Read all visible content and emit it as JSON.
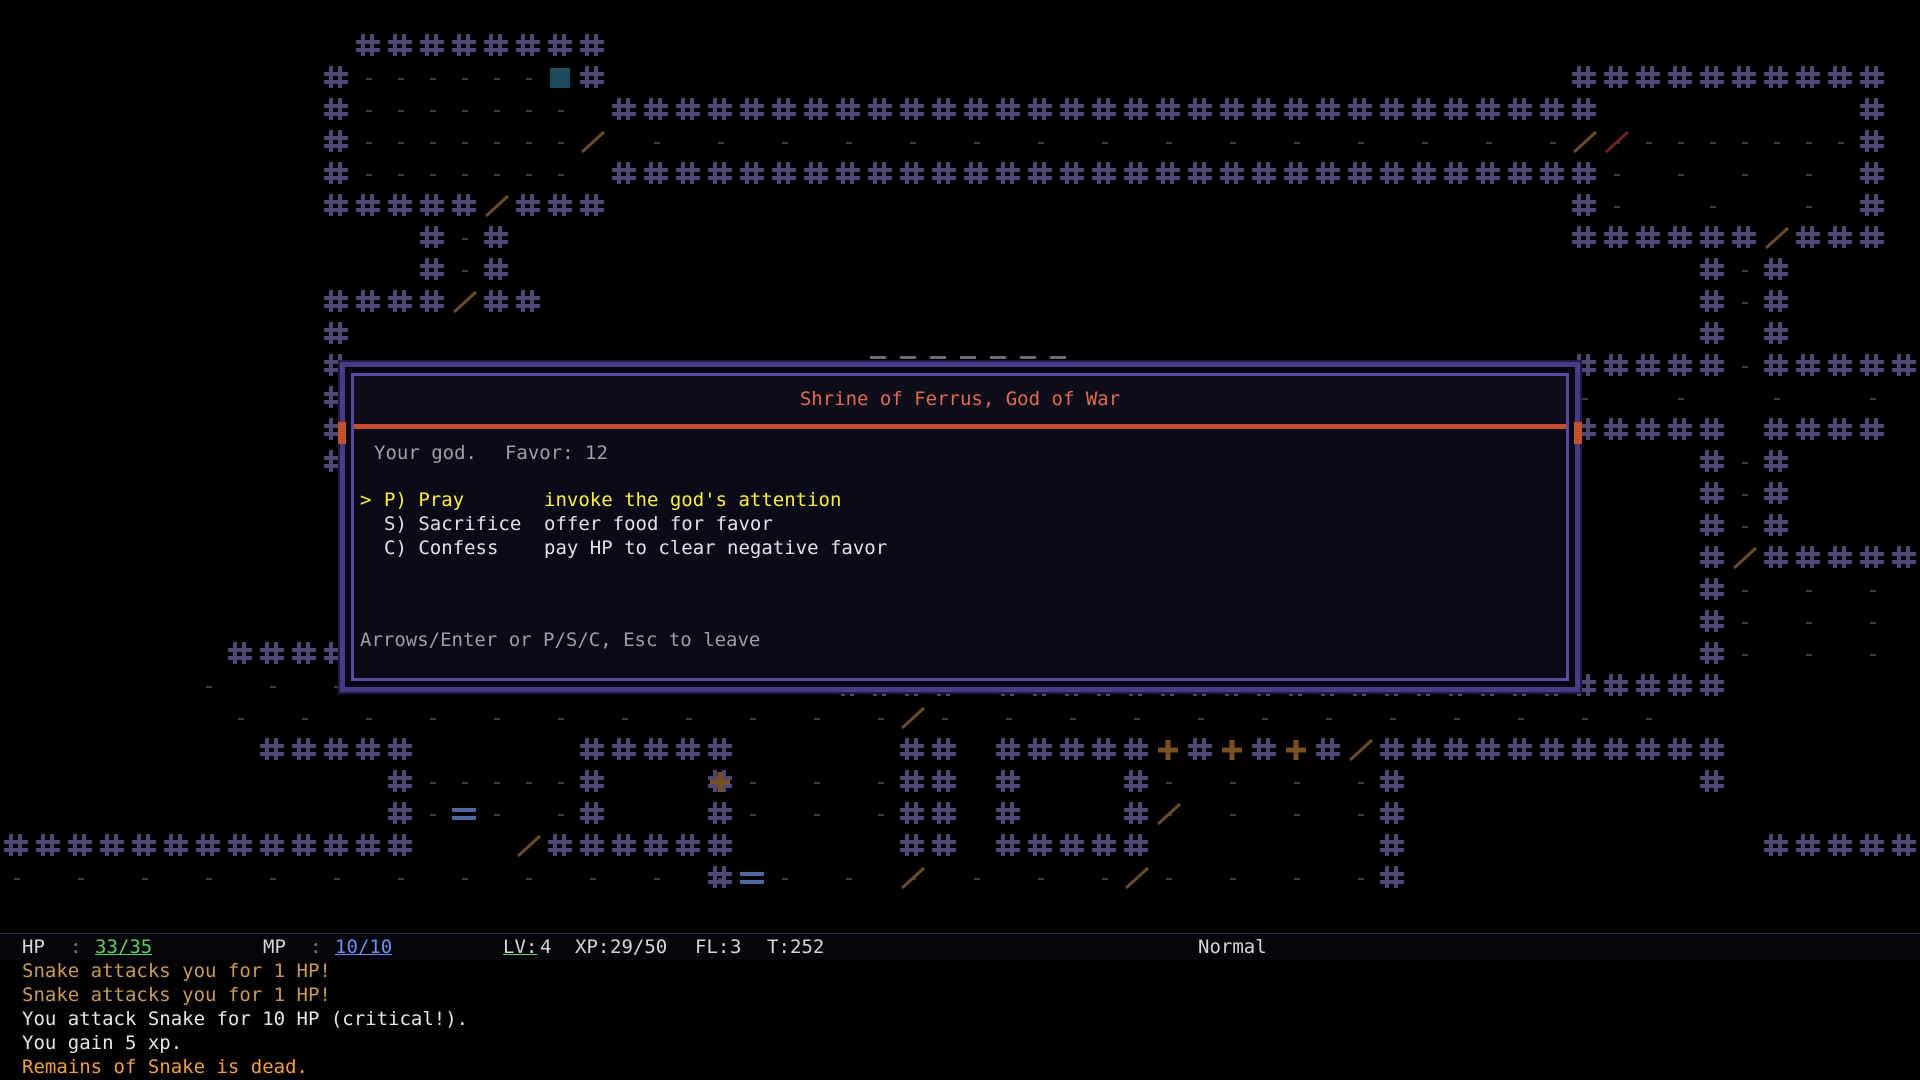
{
  "dialog": {
    "title": "Shrine of Ferrus, God of War",
    "status_text": "Your god.",
    "favor_label": "Favor:",
    "favor_value": "12",
    "options": [
      {
        "cursor": ">",
        "key": "P) Pray",
        "desc": "invoke the god's attention",
        "selected": true
      },
      {
        "cursor": "",
        "key": "S) Sacrifice",
        "desc": "offer food for favor",
        "selected": false
      },
      {
        "cursor": "",
        "key": "C) Confess",
        "desc": "pay HP to clear negative favor",
        "selected": false
      }
    ],
    "hint": "Arrows/Enter or P/S/C, Esc to leave"
  },
  "status": {
    "hp_label": "HP",
    "hp_sep": ":",
    "hp_value": "33/35",
    "mp_label": "MP",
    "mp_sep": ":",
    "mp_value": "10/10",
    "lv_label": "LV:",
    "lv_value": "4",
    "xp_label": "XP:",
    "xp_value": "29/50",
    "fl_label": "FL:",
    "fl_value": "3",
    "t_label": "T:",
    "t_value": "252",
    "mode": "Normal"
  },
  "log": [
    {
      "text": "Snake attacks you for 1 HP!",
      "kind": "attack"
    },
    {
      "text": "Snake attacks you for 1 HP!",
      "kind": "attack"
    },
    {
      "text": "You attack Snake for 10 HP (critical!).",
      "kind": "normal"
    },
    {
      "text": "You gain 5 xp.",
      "kind": "normal"
    },
    {
      "text": "Remains of Snake is dead.",
      "kind": "death"
    }
  ],
  "colors": {
    "wall": "#4d4878",
    "dialog_title": "#e36a52",
    "accent_bar": "#c4502e",
    "selected_option": "#ffef40",
    "hp": "#5cd05c",
    "mp": "#7090f0"
  }
}
